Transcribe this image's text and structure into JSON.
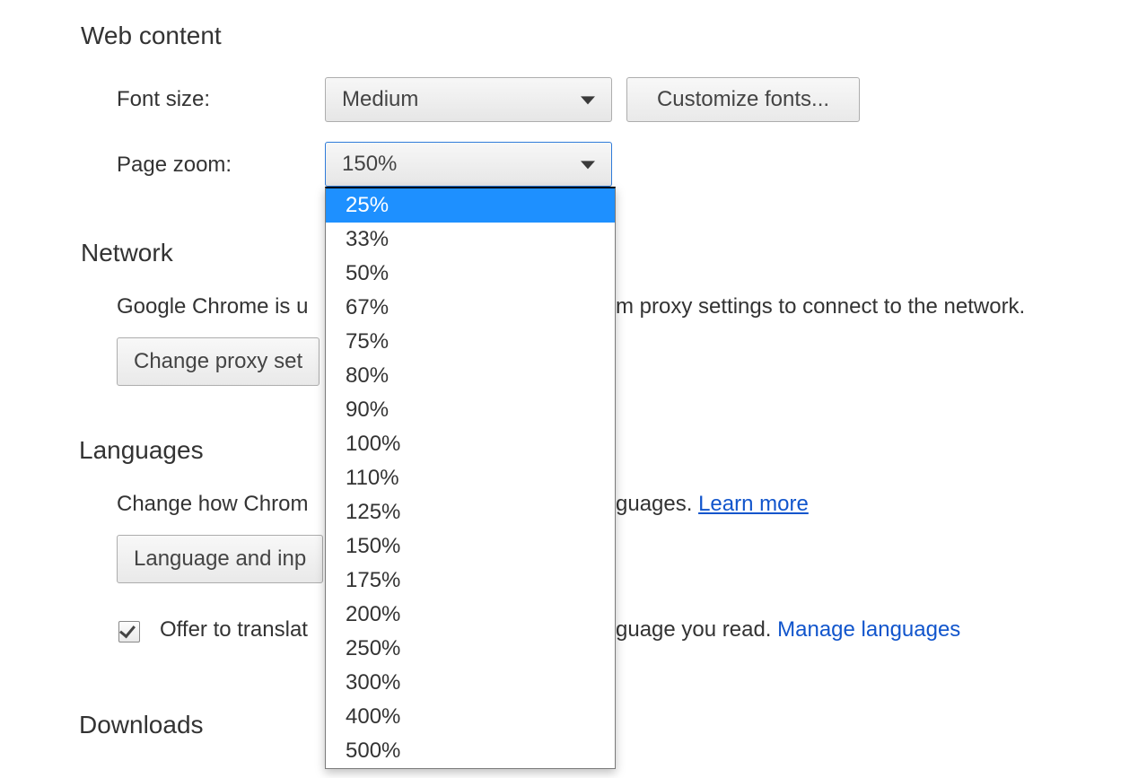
{
  "web_content": {
    "heading": "Web content",
    "font_size_label": "Font size:",
    "font_size_value": "Medium",
    "customize_fonts": "Customize fonts...",
    "page_zoom_label": "Page zoom:",
    "page_zoom_value": "150%",
    "zoom_options": [
      "25%",
      "33%",
      "50%",
      "67%",
      "75%",
      "80%",
      "90%",
      "100%",
      "110%",
      "125%",
      "150%",
      "175%",
      "200%",
      "250%",
      "300%",
      "400%",
      "500%"
    ],
    "zoom_highlight_index": 0
  },
  "network": {
    "heading": "Network",
    "desc_left": "Google Chrome is u",
    "desc_right": "m proxy settings to connect to the network.",
    "change_proxy": "Change proxy set"
  },
  "languages": {
    "heading": "Languages",
    "desc_left": "Change how Chrom",
    "desc_right": "guages. ",
    "learn_more": "Learn more",
    "lang_input_btn": "Language and inp",
    "translate_left": "Offer to translat",
    "translate_right": "guage you read. ",
    "manage_languages": "Manage languages",
    "translate_checked": true
  },
  "downloads": {
    "heading": "Downloads"
  }
}
